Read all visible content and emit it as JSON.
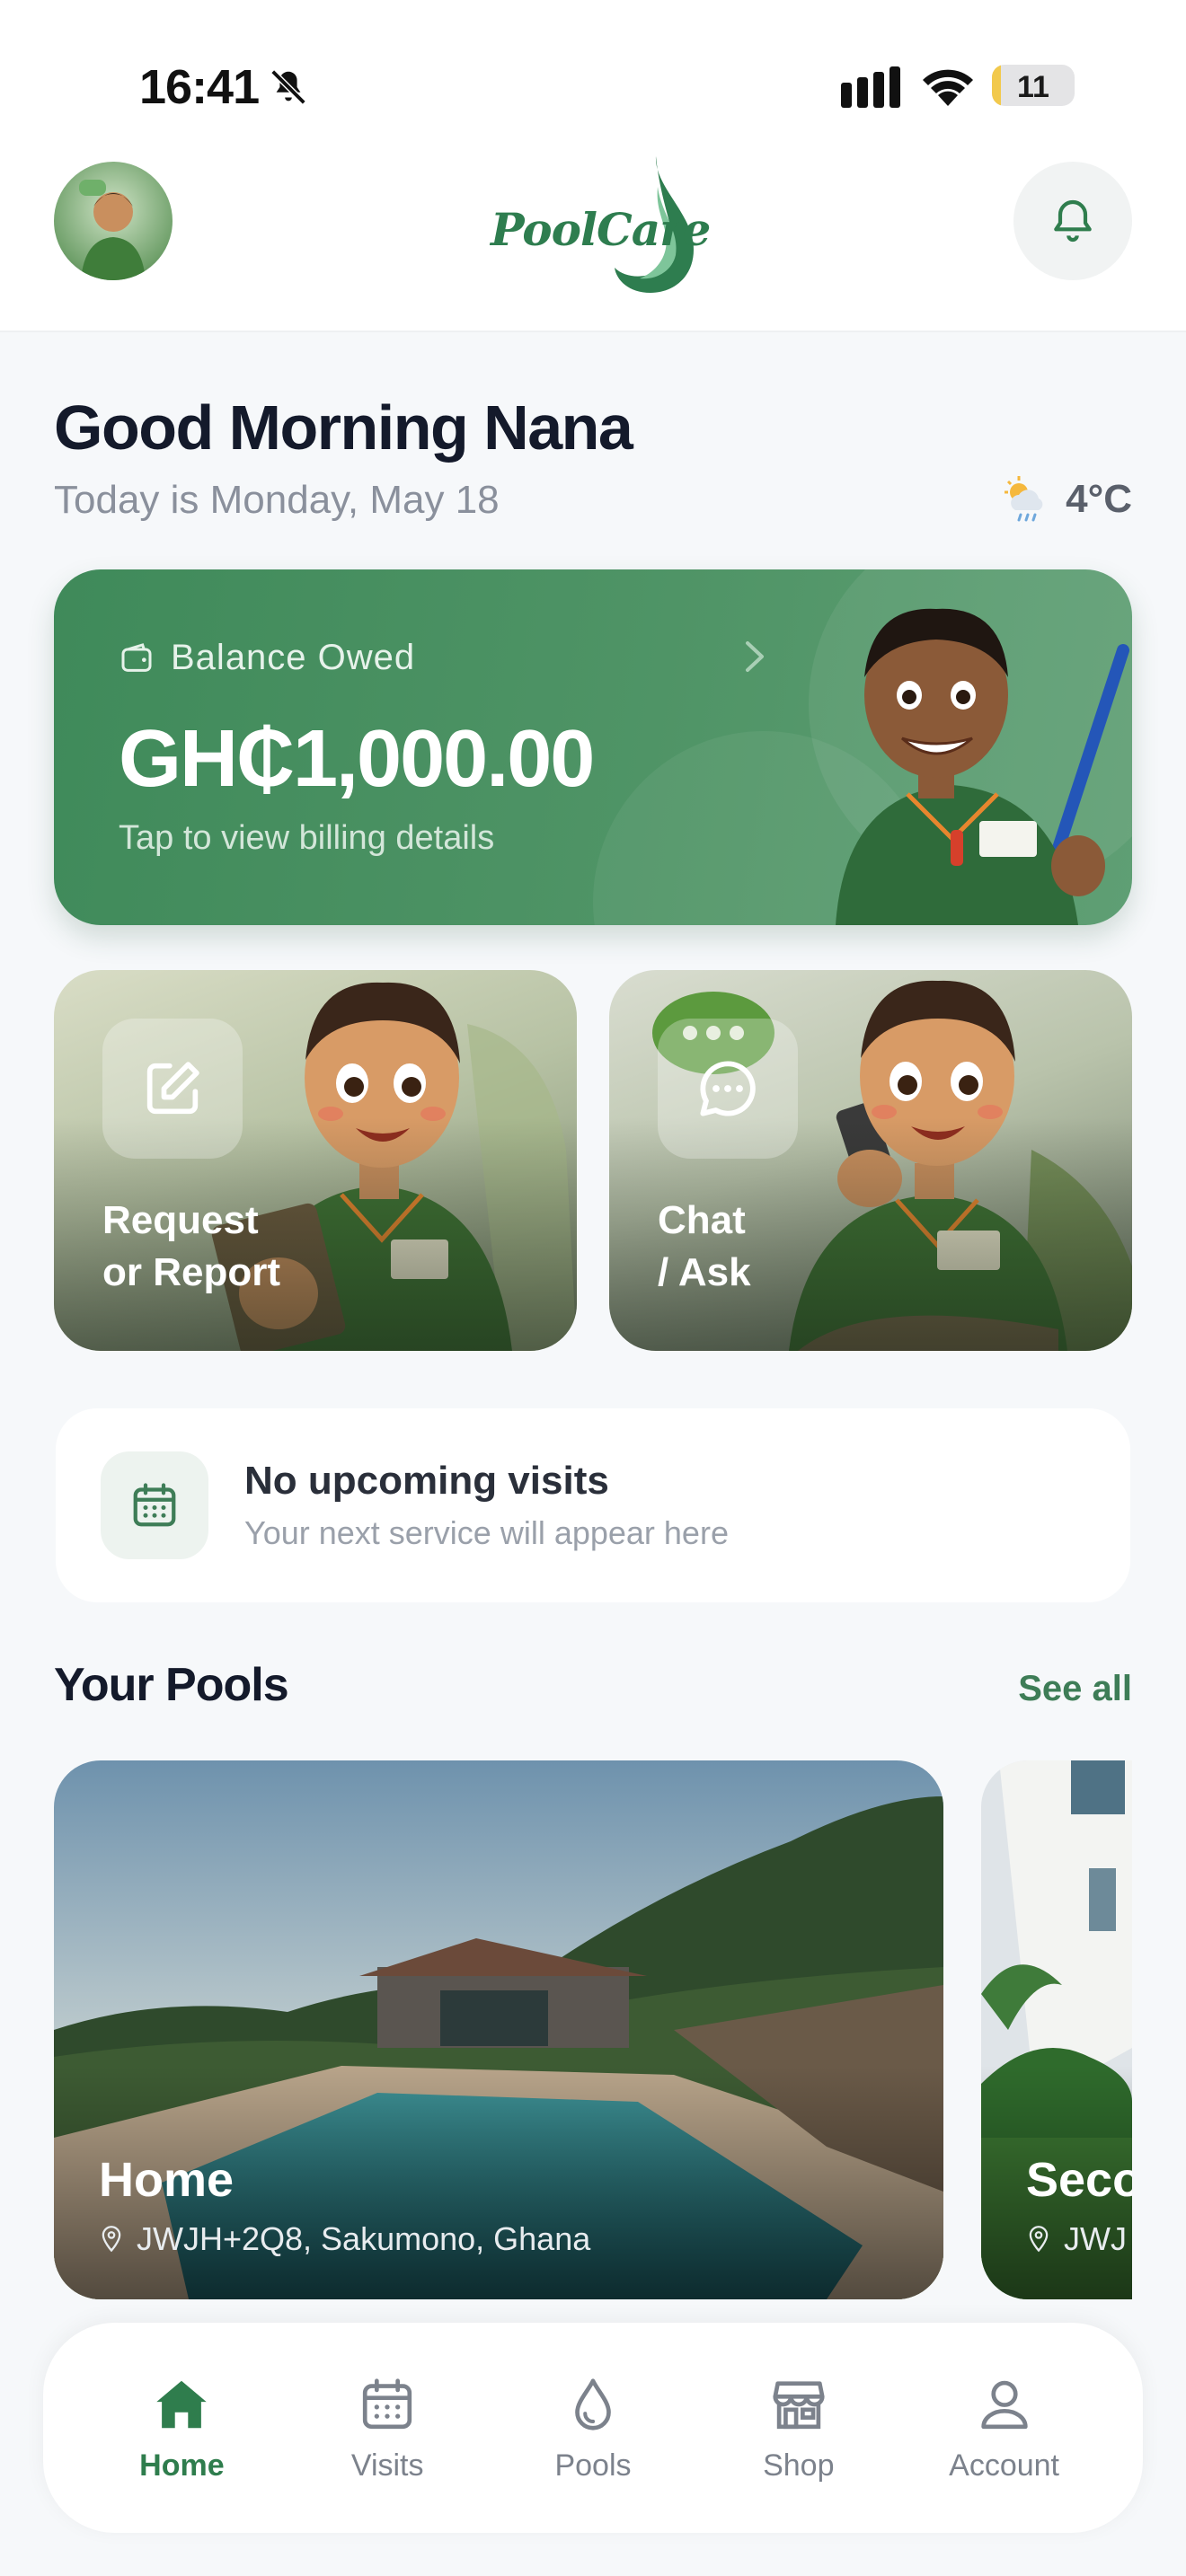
{
  "status_bar": {
    "time": "16:41",
    "battery": "11",
    "battery_level": 0.11
  },
  "header": {
    "logo_text": "PoolCare"
  },
  "greeting": {
    "title": "Good Morning Nana",
    "date": "Today is Monday, May 18",
    "temperature": "4°C",
    "weather_icon": "sun-cloud-rain-icon"
  },
  "balance": {
    "label": "Balance Owed",
    "amount": "GH₵1,000.00",
    "subtitle": "Tap to view billing details"
  },
  "actions": [
    {
      "label_line1": "Request",
      "label_line2": "or Report",
      "icon": "edit-icon"
    },
    {
      "label_line1": "Chat",
      "label_line2": "/ Ask",
      "icon": "chat-icon"
    }
  ],
  "visits": {
    "title": "No upcoming visits",
    "subtitle": "Your next service will appear here"
  },
  "pools": {
    "title": "Your Pools",
    "see_all": "See all",
    "items": [
      {
        "name": "Home",
        "address": "JWJH+2Q8, Sakumono, Ghana"
      },
      {
        "name": "Seco",
        "address": "JWJ"
      }
    ]
  },
  "nav": [
    {
      "label": "Home",
      "active": true
    },
    {
      "label": "Visits",
      "active": false
    },
    {
      "label": "Pools",
      "active": false
    },
    {
      "label": "Shop",
      "active": false
    },
    {
      "label": "Account",
      "active": false
    }
  ],
  "colors": {
    "brand_green": "#3f8a5a",
    "active_nav": "#2f7d4d",
    "battery_fill": "#f2c94c"
  }
}
